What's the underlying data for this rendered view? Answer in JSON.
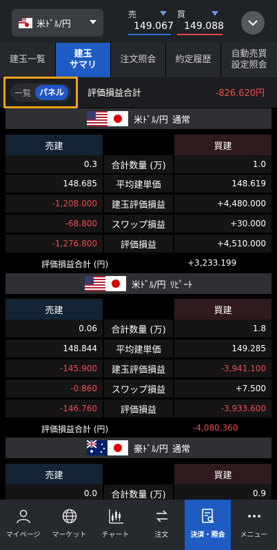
{
  "header": {
    "pair": "米ﾄﾞﾙ/円",
    "sell_label": "売",
    "buy_label": "買",
    "sell_price": "149.067",
    "buy_price": "149.088"
  },
  "tabs": [
    {
      "label": "建玉一覧"
    },
    {
      "label": "建玉\nサマリ"
    },
    {
      "label": "注文照会"
    },
    {
      "label": "約定履歴"
    },
    {
      "label": "自動売買\n設定照会"
    }
  ],
  "summary": {
    "toggle_list": "一覧",
    "toggle_panel": "パネル",
    "label": "評価損益合計",
    "value": "-826.620円"
  },
  "column_labels": {
    "sell": "売建",
    "buy": "買建"
  },
  "row_labels": [
    "合計数量 (万)",
    "平均建単価",
    "建玉評価損益",
    "スワップ損益",
    "評価損益"
  ],
  "panels": [
    {
      "pair": "米ﾄﾞﾙ/円",
      "type": "通常",
      "sell": [
        "0.3",
        "148.685",
        "-1,208.000",
        "-68.800",
        "-1,276.800"
      ],
      "buy": [
        "1.0",
        "148.619",
        "+4,480.000",
        "+30.000",
        "+4,510.000"
      ],
      "total_label": "評価損益合計 (円)",
      "total_value": "+3,233.199"
    },
    {
      "pair": "米ﾄﾞﾙ/円",
      "type": "ﾘﾋﾟｰﾄ",
      "sell": [
        "0.06",
        "148.844",
        "-145.900",
        "-0.860",
        "-146.760"
      ],
      "buy": [
        "1.8",
        "149.285",
        "-3,941.100",
        "+7.500",
        "-3,933.600"
      ],
      "total_label": "評価損益合計 (円)",
      "total_value": "-4,080.360"
    },
    {
      "pair": "豪ﾄﾞﾙ/円",
      "type": "通常",
      "sell": [
        "0.0"
      ],
      "buy": [
        "0.9"
      ]
    }
  ],
  "bottom_nav": [
    {
      "label": "マイページ",
      "icon": "person-icon"
    },
    {
      "label": "マーケット",
      "icon": "globe-icon"
    },
    {
      "label": "チャート",
      "icon": "chart-icon"
    },
    {
      "label": "注文",
      "icon": "exchange-icon"
    },
    {
      "label": "決済・照会",
      "icon": "document-search-icon"
    },
    {
      "label": "メニュー",
      "icon": "more-icon"
    }
  ],
  "colors": {
    "accent": "#1e5bc2",
    "negative": "#f04c4c",
    "highlight_outline": "#f4a21c"
  }
}
